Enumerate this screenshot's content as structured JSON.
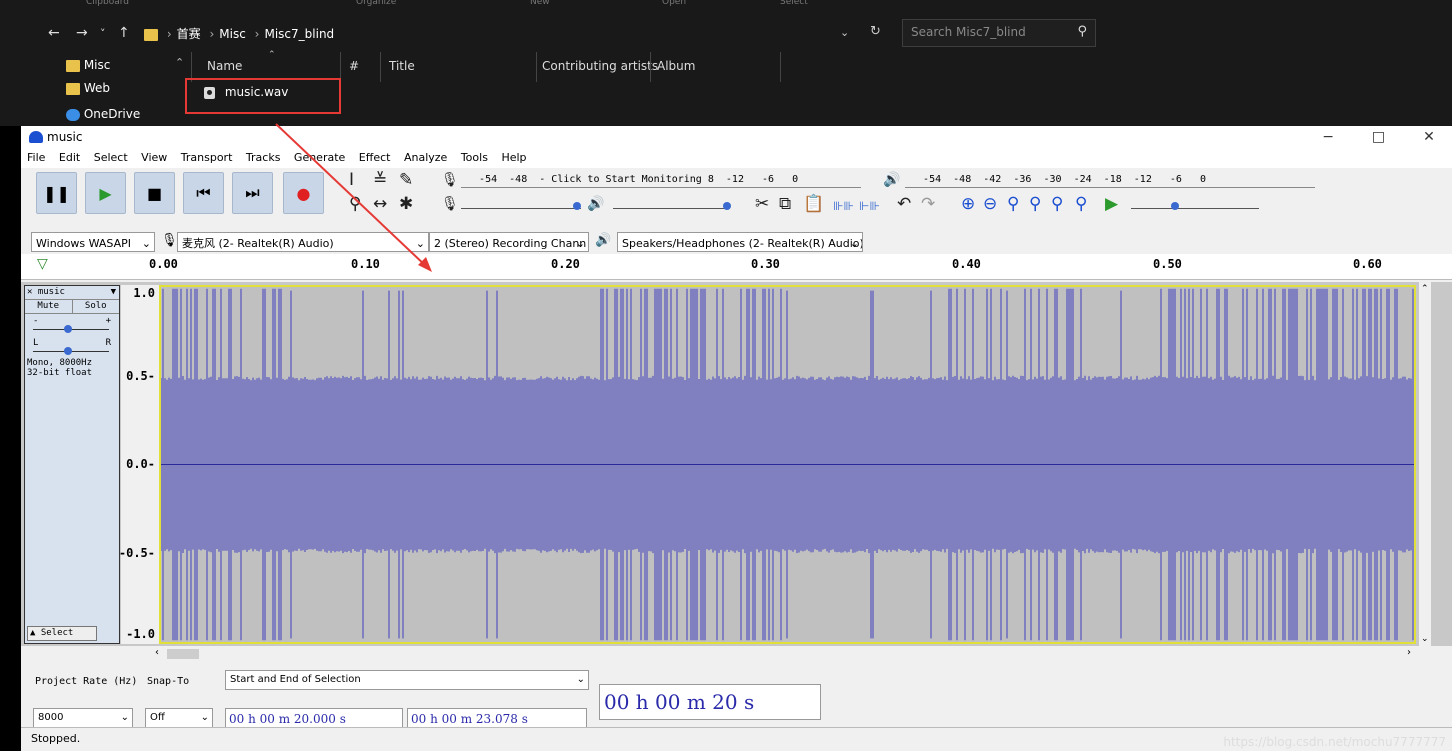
{
  "explorer": {
    "ribbon": [
      "Clipboard",
      "Organize",
      "New",
      "Open",
      "Select"
    ],
    "nav": {
      "back": "←",
      "forward": "→",
      "recent": "˅",
      "up": "↑"
    },
    "breadcrumb": [
      "首赛",
      "Misc",
      "Misc7_blind"
    ],
    "refresh": "↻",
    "search_placeholder": "Search Misc7_blind",
    "sidebar": [
      "Misc",
      "Web",
      "OneDrive"
    ],
    "columns": [
      "Name",
      "#",
      "Title",
      "Contributing artists",
      "Album"
    ],
    "file": "music.wav"
  },
  "app": {
    "title": "music",
    "window": {
      "min": "−",
      "max": "□",
      "close": "✕"
    },
    "menu": [
      "File",
      "Edit",
      "Select",
      "View",
      "Transport",
      "Tracks",
      "Generate",
      "Effect",
      "Analyze",
      "Tools",
      "Help"
    ],
    "meter_record": "   -54  -48  - Click to Start Monitoring 8  -12   -6   0",
    "meter_play": "   -54  -48  -42  -36  -30  -24  -18  -12   -6   0",
    "devices": {
      "host": "Windows WASAPI",
      "input": "麦克风 (2- Realtek(R) Audio)",
      "channels": "2 (Stereo) Recording Chann",
      "output": "Speakers/Headphones (2- Realtek(R) Audio)"
    },
    "ruler": [
      "0.00",
      "0.10",
      "0.20",
      "0.30",
      "0.40",
      "0.50",
      "0.60"
    ],
    "track": {
      "name": "music",
      "mute": "Mute",
      "solo": "Solo",
      "format_line1": "Mono, 8000Hz",
      "format_line2": "32-bit float",
      "select": "Select",
      "vlabels": [
        "1.0",
        "0.5-",
        "0.0-",
        "-0.5-",
        "-1.0"
      ]
    },
    "selection": {
      "rate_label": "Project Rate (Hz)",
      "rate": "8000",
      "snap_label": "Snap-To",
      "snap": "Off",
      "mode": "Start and End of Selection",
      "start": "00 h 00 m 20.000 s",
      "end": "00 h 00 m 23.078 s",
      "position": "00 h 00 m 20 s"
    },
    "status": "Stopped."
  },
  "watermark": "https://blog.csdn.net/mochu7777777"
}
